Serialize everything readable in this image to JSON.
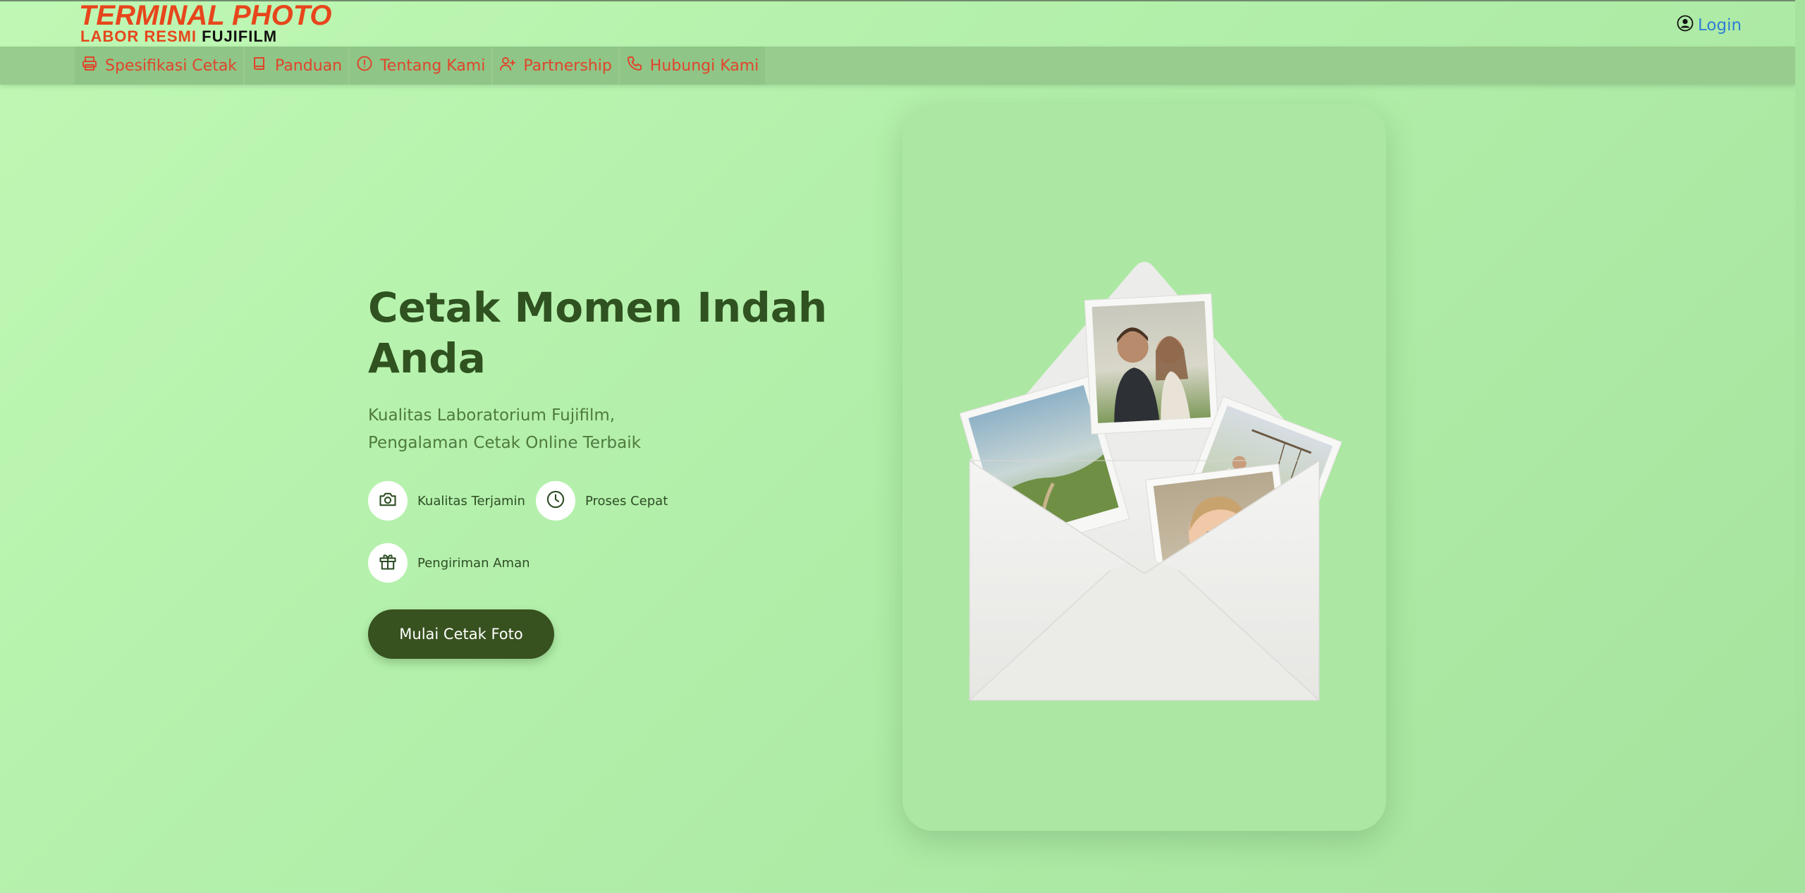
{
  "brand": {
    "line1": "TERMINAL PHOTO",
    "line2a": "LABOR RESMI",
    "line2b": "FUJIFILM"
  },
  "header": {
    "login_label": "Login"
  },
  "nav": {
    "items": [
      {
        "label": "Spesifikasi Cetak",
        "icon": "printer-icon"
      },
      {
        "label": "Panduan",
        "icon": "book-icon"
      },
      {
        "label": "Tentang Kami",
        "icon": "info-icon"
      },
      {
        "label": "Partnership",
        "icon": "user-plus-icon"
      },
      {
        "label": "Hubungi Kami",
        "icon": "phone-icon"
      }
    ]
  },
  "hero": {
    "title": "Cetak Momen Indah Anda",
    "subtitle_line1": "Kualitas Laboratorium Fujifilm,",
    "subtitle_line2": "Pengalaman Cetak Online Terbaik",
    "features": [
      {
        "label": "Kualitas Terjamin",
        "icon": "camera-icon"
      },
      {
        "label": "Proses Cepat",
        "icon": "clock-icon"
      },
      {
        "label": "Pengiriman Aman",
        "icon": "gift-icon"
      }
    ],
    "cta_label": "Mulai Cetak Foto"
  },
  "colors": {
    "nav_text": "#e0452b",
    "title": "#2f5220",
    "cta_bg": "#37511f",
    "login": "#2f7fd4"
  }
}
